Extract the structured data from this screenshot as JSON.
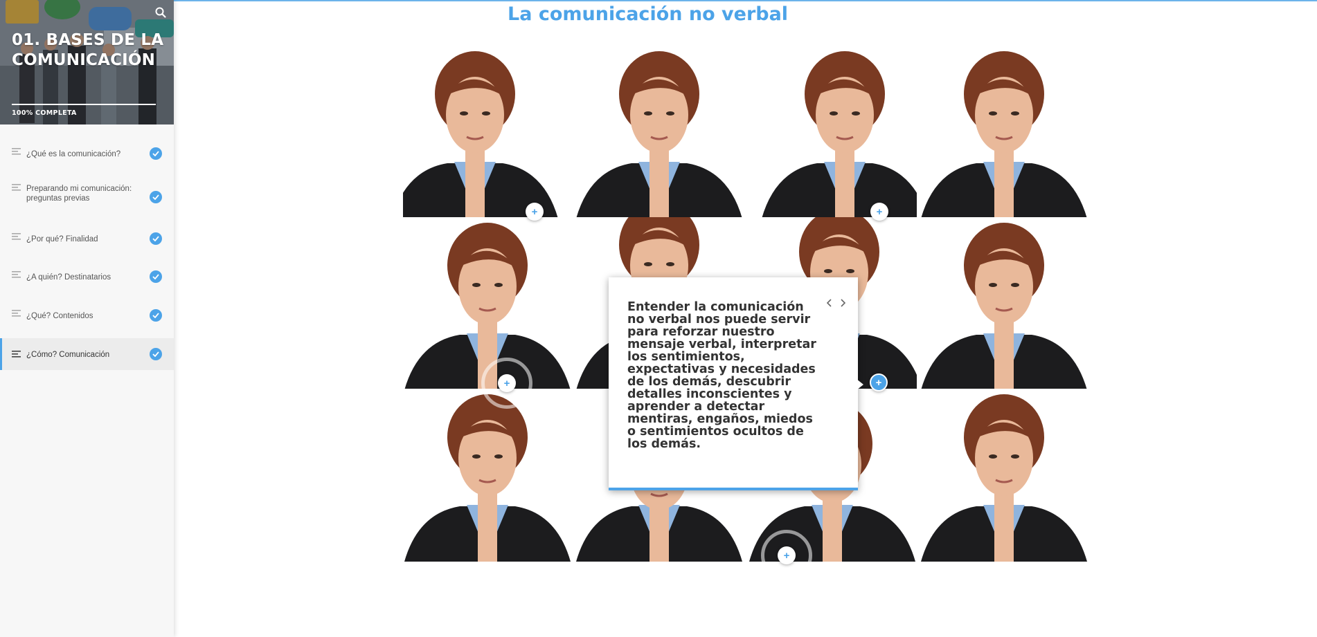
{
  "course": {
    "title": "01. BASES DE LA COMUNICACIÓN",
    "progress_label": "100% COMPLETA",
    "progress_value": 1.0
  },
  "lessons": [
    {
      "label": "¿Qué es la comunicación?",
      "completed": true,
      "active": false
    },
    {
      "label": "Preparando mi comunicación: preguntas previas",
      "completed": true,
      "active": false
    },
    {
      "label": "¿Por qué? Finalidad",
      "completed": true,
      "active": false
    },
    {
      "label": "¿A quién? Destinatarios",
      "completed": true,
      "active": false
    },
    {
      "label": "¿Qué? Contenidos",
      "completed": true,
      "active": false
    },
    {
      "label": "¿Cómo? Comunicación",
      "completed": true,
      "active": true
    }
  ],
  "main": {
    "title": "La comunicación no verbal"
  },
  "popup": {
    "text": "Entender la comunicación no verbal nos puede servir para reforzar nuestro mensaje verbal, interpretar los sentimientos, expectativas y necesidades de los demás, descubrir detalles inconscientes y aprender a detectar mentiras, engaños, miedos o sentimientos ocultos de los demás."
  },
  "hotspot_symbol": "+",
  "colors": {
    "accent": "#4ca3e8",
    "sidebar_bg": "#f7f7f7",
    "jacket": "#1c1c1e",
    "shirt": "#8fb4de",
    "hair": "#7a3a22",
    "skin": "#e9b99a"
  },
  "icons": [
    "search-icon",
    "lesson-menu-icon",
    "check-icon",
    "chevron-left-icon",
    "chevron-right-icon",
    "plus-icon"
  ]
}
